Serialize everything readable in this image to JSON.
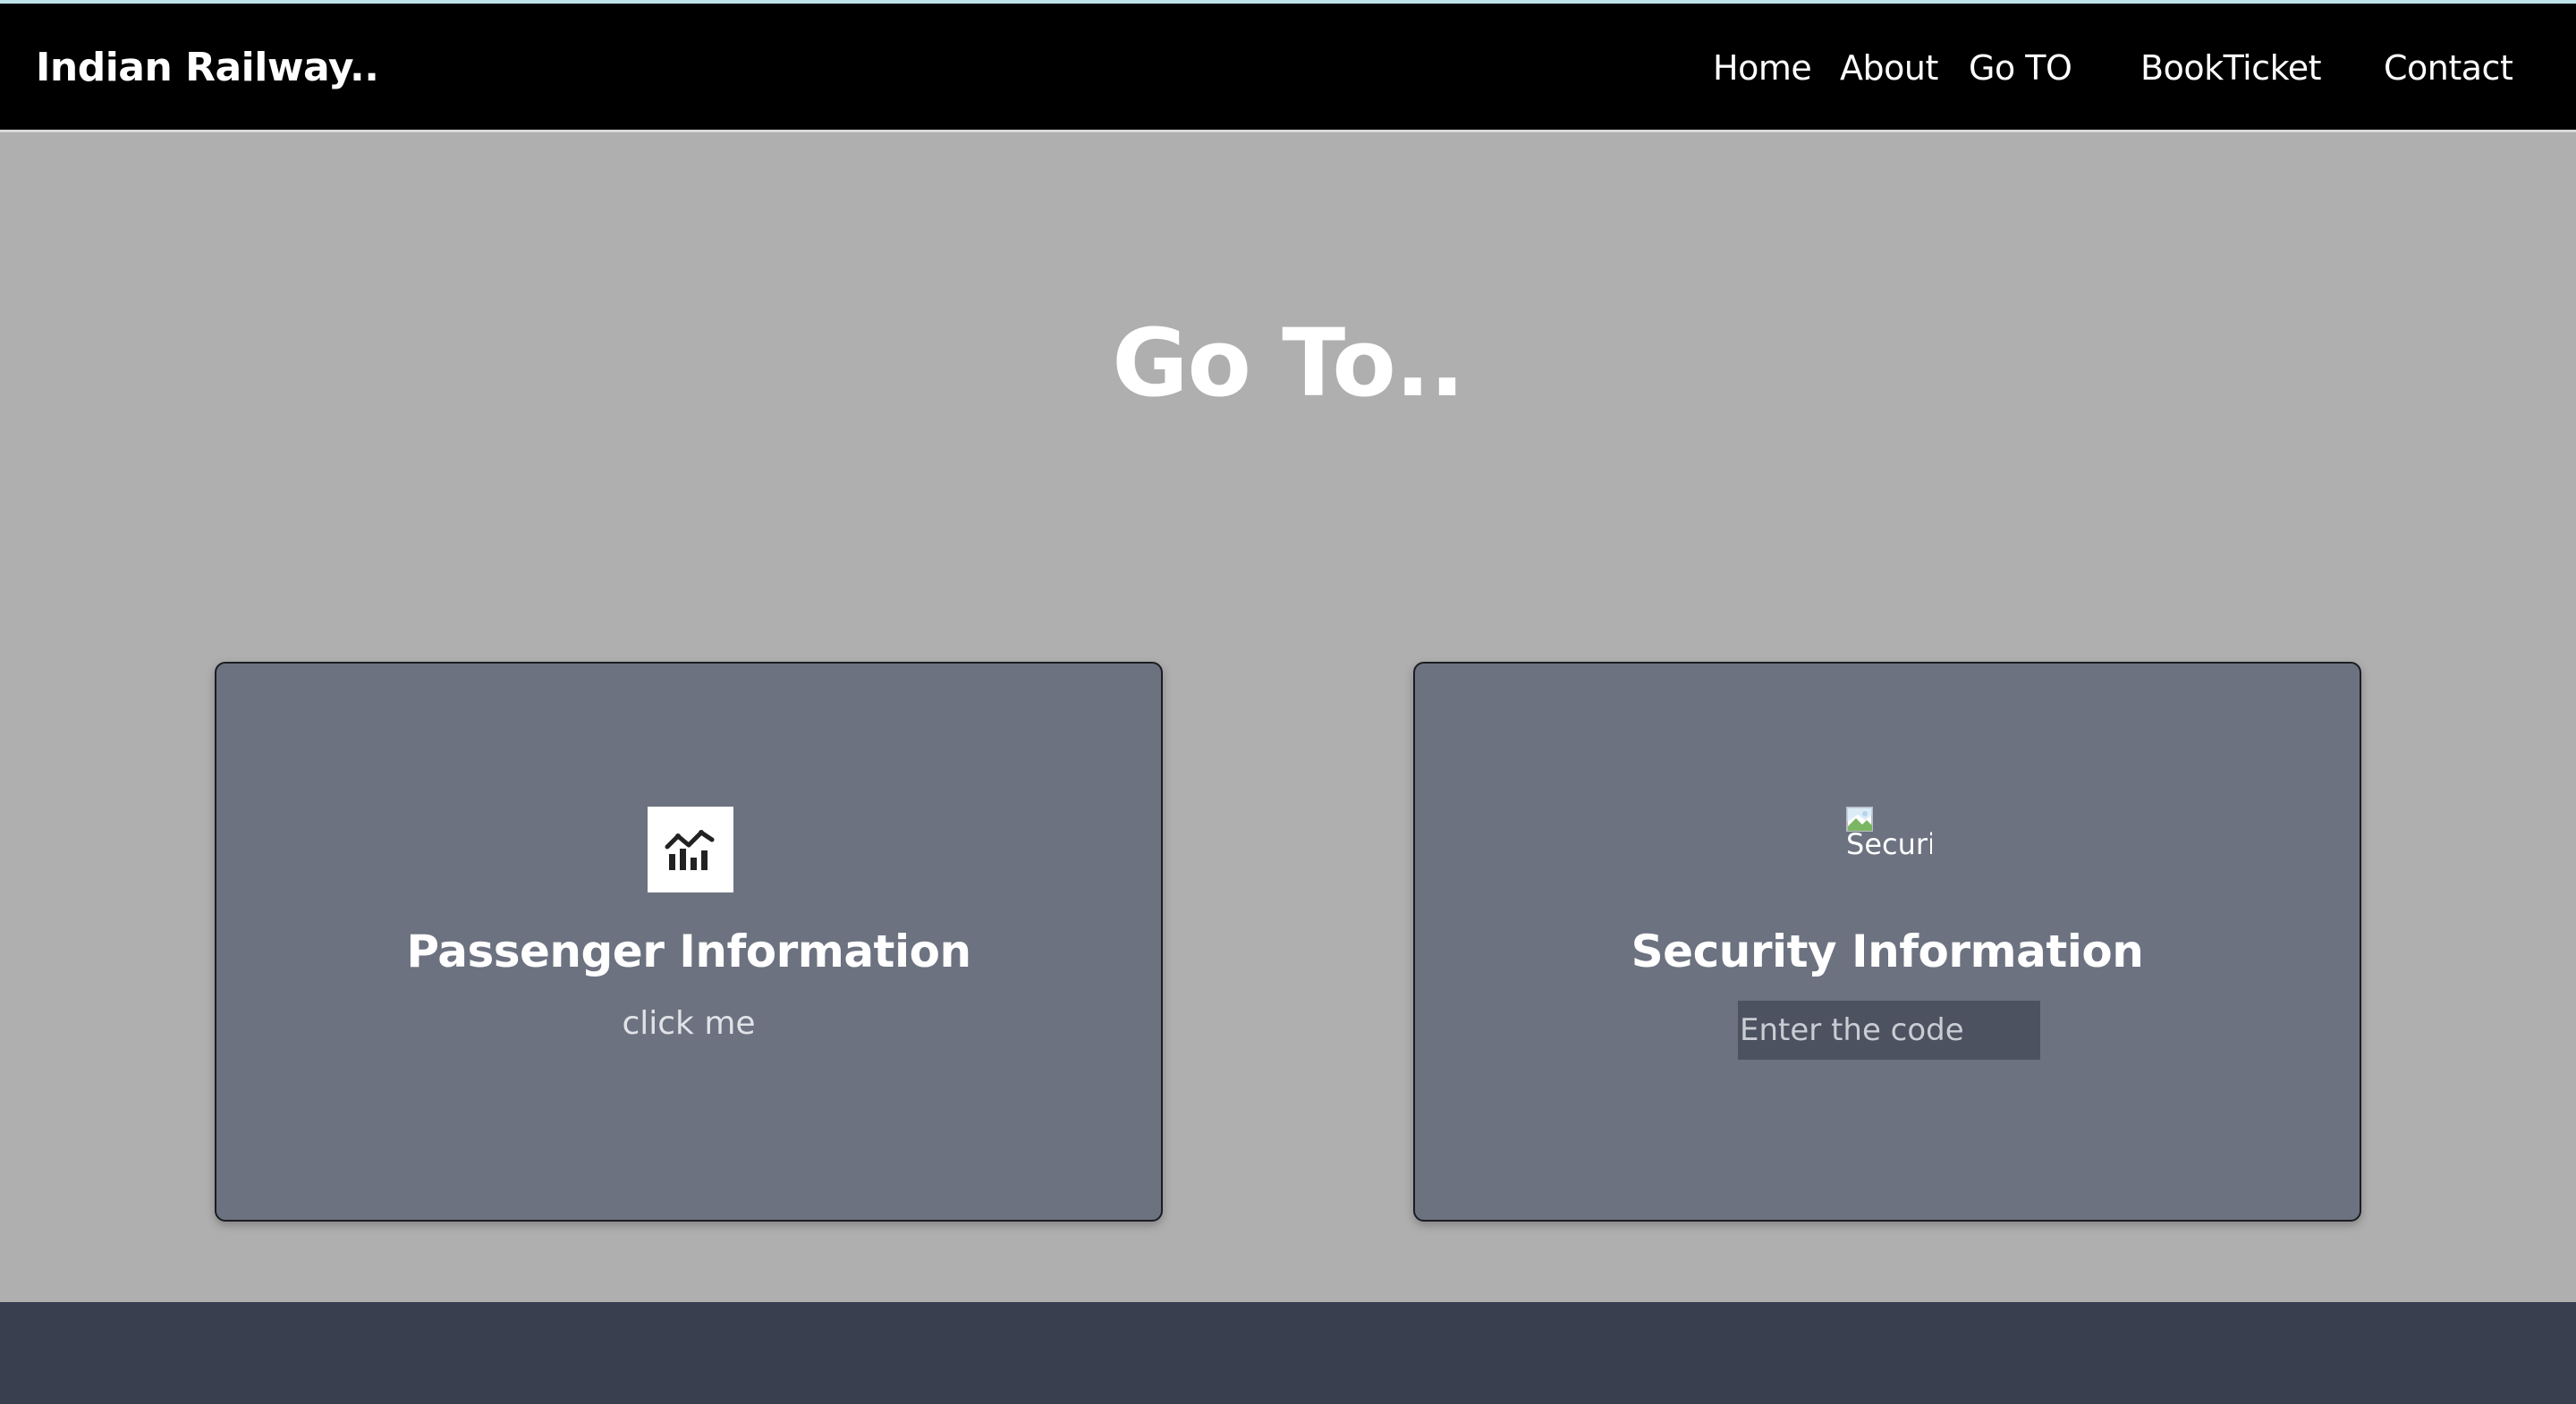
{
  "navbar": {
    "brand": "Indian Railway..",
    "links": [
      {
        "label": "Home"
      },
      {
        "label": "About"
      },
      {
        "label": "Go TO"
      },
      {
        "label": "BookTicket"
      },
      {
        "label": "Contact"
      }
    ]
  },
  "main": {
    "title": "Go To..",
    "cards": [
      {
        "title": "Passenger Information",
        "link_label": "click me",
        "icon": "bar-chart-trend-icon"
      },
      {
        "title": "Security Information",
        "image_alt": "Securit",
        "input_placeholder": "Enter the code",
        "input_value": ""
      }
    ]
  },
  "colors": {
    "navbar_bg": "#000000",
    "page_bg": "#afafaf",
    "card_bg": "#6c7280",
    "input_bg": "#4d5260",
    "footer_bg": "#393f4f"
  }
}
